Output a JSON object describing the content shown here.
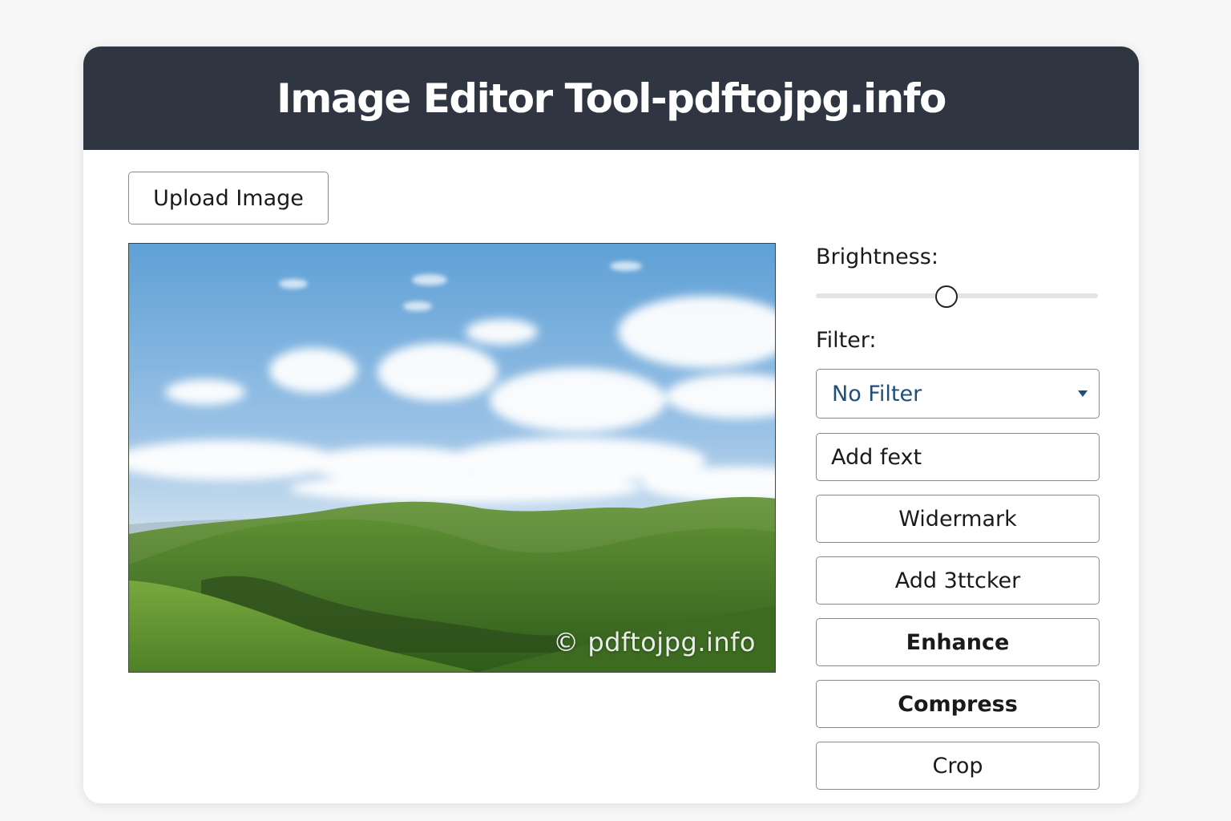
{
  "header": {
    "title": "Image Editor Tool-pdftojpg.info"
  },
  "toolbar": {
    "upload_label": "Upload Image"
  },
  "preview": {
    "watermark": "© pdftojpg.info"
  },
  "controls": {
    "brightness_label": "Brightness:",
    "brightness_level": 0.46,
    "filter_label": "Filter:",
    "filter_selected": "No Filter",
    "buttons": {
      "add_text": "Add fext",
      "watermark": "Widermark",
      "add_sticker": "Add 3ttcker",
      "enhance": "Enhance",
      "compress": "Compress",
      "crop": "Crop"
    }
  },
  "colors": {
    "header_bg": "#2f3541",
    "filter_text": "#1f4e79"
  }
}
